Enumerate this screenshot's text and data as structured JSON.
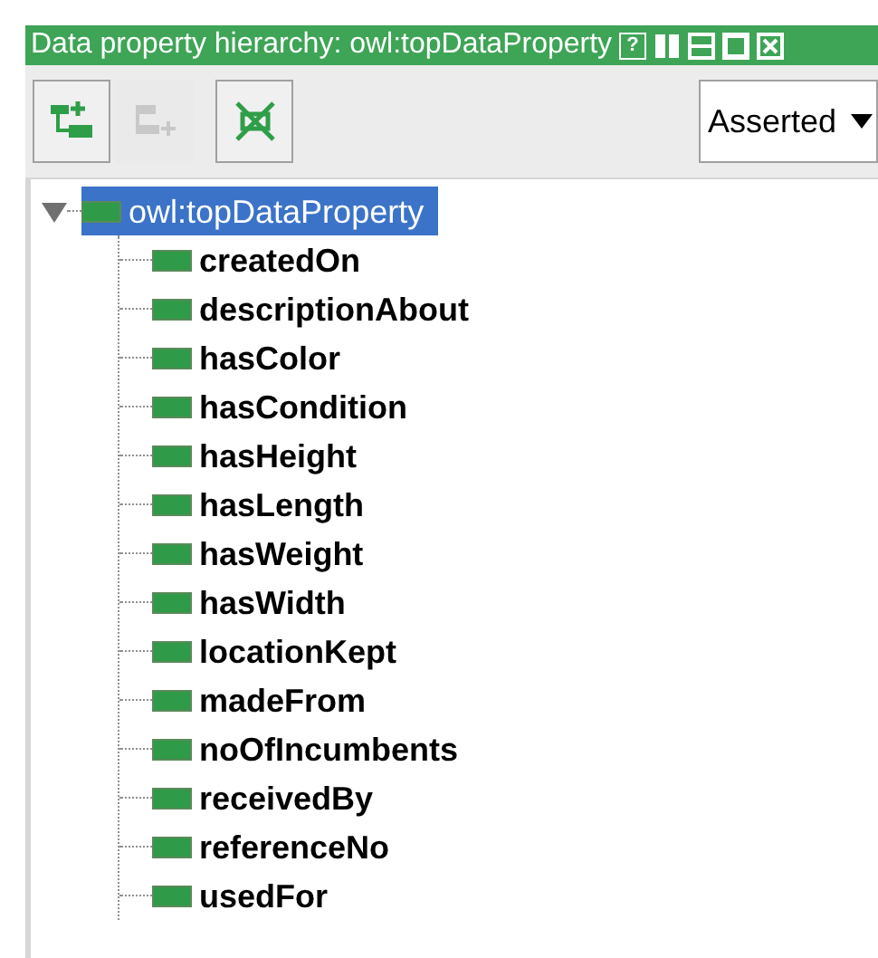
{
  "window": {
    "title": "Data property hierarchy: owl:topDataProperty",
    "help": "?"
  },
  "toolbar": {
    "buttons": [
      {
        "kind": "add-sub",
        "disabled": false
      },
      {
        "kind": "add-sibling",
        "disabled": true
      },
      {
        "kind": "delete",
        "disabled": false
      }
    ],
    "view_select": {
      "value": "Asserted"
    }
  },
  "tree": {
    "root": {
      "label": "owl:topDataProperty",
      "selected": true,
      "expanded": true,
      "children": [
        {
          "label": "createdOn",
          "selected": false
        },
        {
          "label": "descriptionAbout",
          "selected": false
        },
        {
          "label": "hasColor",
          "selected": false
        },
        {
          "label": "hasCondition",
          "selected": false
        },
        {
          "label": "hasHeight",
          "selected": false
        },
        {
          "label": "hasLength",
          "selected": false
        },
        {
          "label": "hasWeight",
          "selected": false
        },
        {
          "label": "hasWidth",
          "selected": false
        },
        {
          "label": "locationKept",
          "selected": false
        },
        {
          "label": "madeFrom",
          "selected": false
        },
        {
          "label": "noOfIncumbents",
          "selected": false
        },
        {
          "label": "receivedBy",
          "selected": false
        },
        {
          "label": "referenceNo",
          "selected": false
        },
        {
          "label": "usedFor",
          "selected": false
        }
      ]
    }
  }
}
